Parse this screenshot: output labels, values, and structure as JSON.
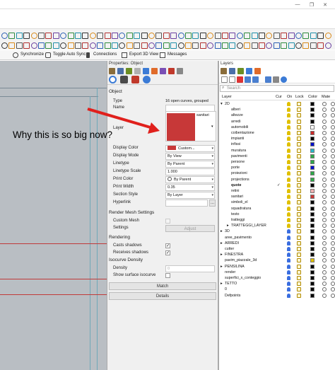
{
  "window_controls": [
    "—",
    "❐",
    "✕"
  ],
  "command_bar": {
    "items": [
      {
        "label": "Synchronize",
        "icon": "sync-icon"
      },
      {
        "label": "Toggle Auto Sync",
        "icon": "auto-sync-icon"
      },
      {
        "label": "Connections",
        "icon": "connections-icon"
      },
      {
        "label": "Export 3D View",
        "icon": "export-icon"
      },
      {
        "label": "Messages",
        "icon": "messages-icon"
      }
    ]
  },
  "properties": {
    "title": "Properties: Object",
    "section_object": "Object",
    "type_label": "Type",
    "type_value": "16 open curves, grouped",
    "name_label": "Name",
    "name_value": "sanitari",
    "layer_label": "Layer",
    "layer_color": "#c73838",
    "rows": [
      {
        "label": "Display Color",
        "value": "Custom..."
      },
      {
        "label": "Display Mode",
        "value": "By View"
      },
      {
        "label": "Linetype",
        "value": "By Parent"
      },
      {
        "label": "Linetype Scale",
        "value": "1.000"
      },
      {
        "label": "Print Color",
        "value": "By Parent"
      },
      {
        "label": "Print Width",
        "value": "0.35"
      },
      {
        "label": "Section Style",
        "value": "By Layer"
      },
      {
        "label": "Hyperlink",
        "value": ""
      }
    ],
    "section_render_mesh": "Render Mesh Settings",
    "custom_mesh_label": "Custom Mesh",
    "settings_label": "Settings",
    "adjust_button": "Adjust",
    "section_rendering": "Rendering",
    "casts_shadows_label": "Casts shadows",
    "receives_shadows_label": "Receives shadows",
    "section_isocurve": "Isocurve Density",
    "density_label": "Density",
    "density_value": "0",
    "show_surface_isocurve_label": "Show surface isocurve",
    "match_button": "Match",
    "details_button": "Details"
  },
  "annotation": {
    "text": "Why this is so big now?"
  },
  "layers_panel": {
    "title": "Layers",
    "search_placeholder": "Search",
    "headers": [
      "Layer",
      "Cur",
      "On",
      "Lock",
      "Color",
      "Mate"
    ],
    "rows": [
      {
        "name": "2D",
        "indent": 0,
        "expander": "▾",
        "bulb": "#e0c000",
        "color": "#000000"
      },
      {
        "name": "alberi",
        "indent": 1,
        "bulb": "#e0c000",
        "color": "#000000"
      },
      {
        "name": "altezze",
        "indent": 1,
        "bulb": "#e0c000",
        "color": "#000000"
      },
      {
        "name": "arredi",
        "indent": 1,
        "bulb": "#e0c000",
        "color": "#000000"
      },
      {
        "name": "automobili",
        "indent": 1,
        "bulb": "#e0c000",
        "color": "#ffffff"
      },
      {
        "name": "coibentazione",
        "indent": 1,
        "bulb": "#e0c000",
        "color": "#cc2a2a"
      },
      {
        "name": "impianti",
        "indent": 1,
        "bulb": "#e0c000",
        "color": "#000000"
      },
      {
        "name": "infissi",
        "indent": 1,
        "bulb": "#e0c000",
        "color": "#0010cc"
      },
      {
        "name": "muratura",
        "indent": 1,
        "bulb": "#e0c000",
        "color": "#29b8c8"
      },
      {
        "name": "pavimenti",
        "indent": 1,
        "bulb": "#e0c000",
        "color": "#2ea84a"
      },
      {
        "name": "persone",
        "indent": 1,
        "bulb": "#e0c000",
        "color": "#2ea84a"
      },
      {
        "name": "porte",
        "indent": 1,
        "bulb": "#e0c000",
        "color": "#0010cc"
      },
      {
        "name": "proiezioni",
        "indent": 1,
        "bulb": "#e0c000",
        "color": "#2ea84a"
      },
      {
        "name": "projections",
        "indent": 1,
        "bulb": "#e0c000",
        "color": "#2ea84a"
      },
      {
        "name": "quote",
        "indent": 1,
        "bulb": "#e0c000",
        "color": "#000000",
        "bold": true,
        "current": "✓"
      },
      {
        "name": "retini",
        "indent": 1,
        "bulb": "#e0c000",
        "color": "#f0b0b0"
      },
      {
        "name": "sanitari",
        "indent": 1,
        "bulb": "#e0c000",
        "color": "#c73838"
      },
      {
        "name": "simboli_el",
        "indent": 1,
        "bulb": "#e0c000",
        "color": "#000000"
      },
      {
        "name": "squadratura",
        "indent": 1,
        "bulb": "#e0c000",
        "color": "#000000"
      },
      {
        "name": "testo",
        "indent": 1,
        "bulb": "#e0c000",
        "color": "#000000"
      },
      {
        "name": "tratteggi",
        "indent": 1,
        "bulb": "#e0c000",
        "color": "#000000"
      },
      {
        "name": "TRATTEGGI_LAYER",
        "indent": 1,
        "expander": "▸",
        "bulb": "#e0c000",
        "color": "#000000"
      },
      {
        "name": "3D",
        "indent": 0,
        "expander": "▸",
        "bulb": "#3a6ee0",
        "color": "#000000"
      },
      {
        "name": "aree_pavimento",
        "indent": 0,
        "bulb": "#3a6ee0",
        "color": "#000000"
      },
      {
        "name": "ARREDI",
        "indent": 0,
        "expander": "▸",
        "bulb": "#3a6ee0",
        "color": "#000000"
      },
      {
        "name": "cutter",
        "indent": 0,
        "bulb": "#3a6ee0",
        "color": "#000000"
      },
      {
        "name": "FINESTRA",
        "indent": 0,
        "expander": "▸",
        "bulb": "#3a6ee0",
        "color": "#000000"
      },
      {
        "name": "pavim_piazzale_3d",
        "indent": 0,
        "bulb": "#3a6ee0",
        "color": "#e0c000"
      },
      {
        "name": "PENSILINA",
        "indent": 0,
        "expander": "▸",
        "bulb": "#3a6ee0",
        "color": "#000000"
      },
      {
        "name": "render",
        "indent": 0,
        "bulb": "#3a6ee0",
        "color": "#000000"
      },
      {
        "name": "superfici_x_conteggio",
        "indent": 0,
        "bulb": "#3a6ee0",
        "color": "#000000"
      },
      {
        "name": "TETTO",
        "indent": 0,
        "expander": "▸",
        "bulb": "#3a6ee0",
        "color": "#000000"
      },
      {
        "name": "0",
        "indent": 0,
        "bulb": "#3a6ee0",
        "color": "#000000"
      },
      {
        "name": "Defpoints",
        "indent": 0,
        "bulb": "#3a6ee0",
        "color": "#000000"
      }
    ]
  }
}
